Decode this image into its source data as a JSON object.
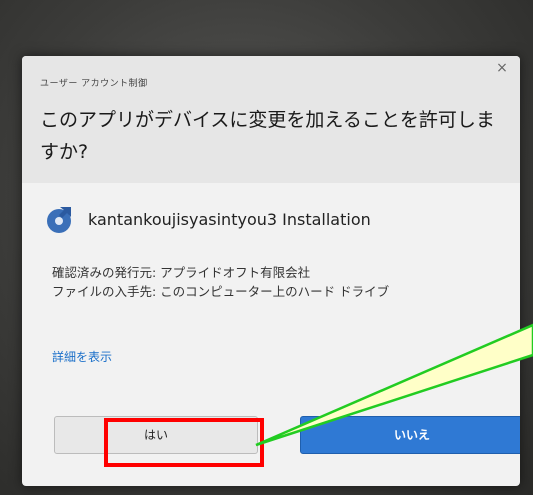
{
  "dialog": {
    "header_label": "ユーザー アカウント制御",
    "close_glyph": "×",
    "question": "このアプリがデバイスに変更を加えることを許可しますか?",
    "app_name": "kantankoujisyasintyou3 Installation",
    "publisher_line": "確認済みの発行元: アプライドオフト有限会社",
    "source_line": "ファイルの入手先: このコンピューター上のハード ドライブ",
    "details_link": "詳細を表示",
    "yes_label": "はい",
    "no_label": "いいえ"
  },
  "annotation": {
    "highlight_color": "#ff0000",
    "callout_fill": "#ffffc8",
    "callout_stroke": "#22cc22"
  },
  "icons": {
    "app": "installer-disc-icon",
    "close": "close-icon"
  },
  "colors": {
    "primary_button": "#2f79d4",
    "link": "#1a6fc9"
  }
}
